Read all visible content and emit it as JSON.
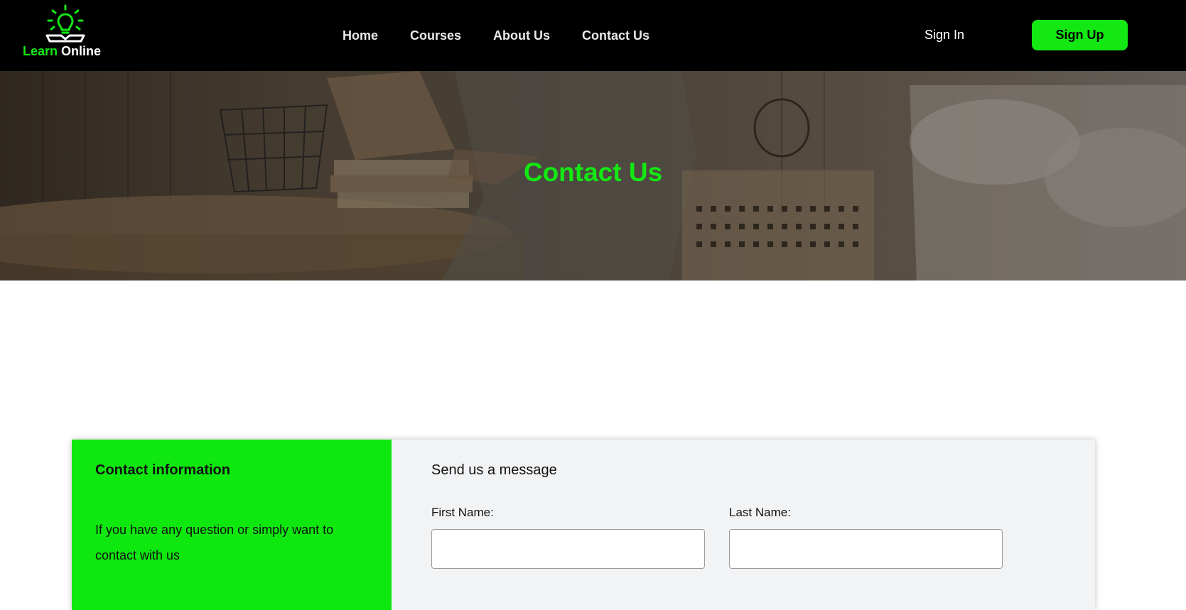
{
  "brand": {
    "word1": "Learn",
    "word2": "Online",
    "accent": "#13e813"
  },
  "nav": {
    "items": [
      "Home",
      "Courses",
      "About Us",
      "Contact Us"
    ]
  },
  "auth": {
    "signin": "Sign In",
    "signup": "Sign Up"
  },
  "hero": {
    "title": "Contact Us"
  },
  "contact_info": {
    "title": "Contact information",
    "text": "If you have any question or simply want to contact with us"
  },
  "message_form": {
    "title": "Send us a message",
    "first_name_label": "First Name:",
    "last_name_label": "Last Name:",
    "first_name_value": "",
    "last_name_value": ""
  }
}
